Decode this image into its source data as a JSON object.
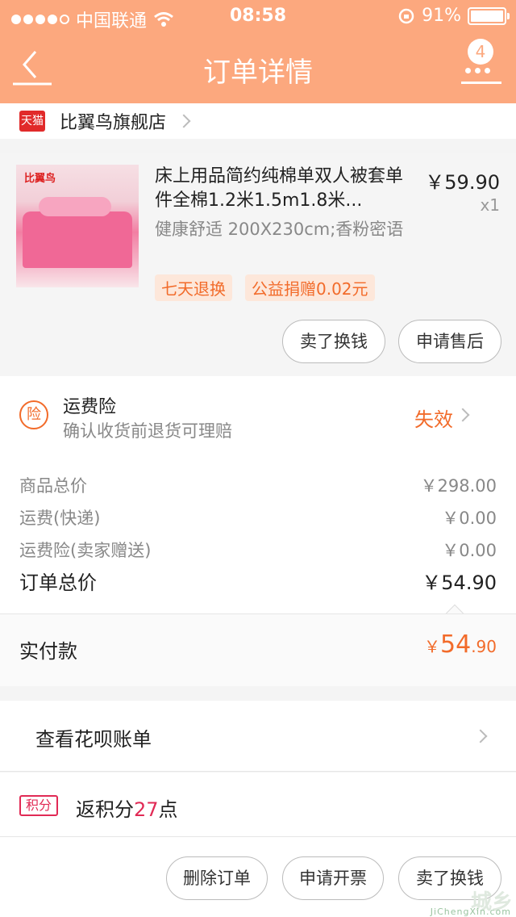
{
  "status_bar": {
    "carrier": "中国联通",
    "time": "08:58",
    "battery": "91%"
  },
  "navbar": {
    "title": "订单详情",
    "badge_count": "4",
    "icons": [
      "back-arrow-icon",
      "more-icon"
    ]
  },
  "shop": {
    "badge": "天猫",
    "name": "比翼鸟旗舰店"
  },
  "product": {
    "thumb_logo": "比翼鸟",
    "title": "床上用品简约纯棉单双人被套单件全棉1.2米1.5m1.8米...",
    "sku": "健康舒适 200X230cm;香粉密语",
    "price": "￥59.90",
    "quantity": "x1",
    "tags": [
      "七天退换",
      "公益捐赠0.02元"
    ],
    "buttons": [
      "卖了换钱",
      "申请售后"
    ]
  },
  "insurance": {
    "icon_text": "险",
    "title": "运费险",
    "desc": "确认收货前退货可理赔",
    "status": "失效"
  },
  "summary": {
    "rows": [
      {
        "label": "商品总价",
        "value": "￥298.00"
      },
      {
        "label": "运费(快递)",
        "value": "￥0.00"
      },
      {
        "label": "运费险(卖家赠送)",
        "value": "￥0.00"
      }
    ],
    "total": {
      "label": "订单总价",
      "value": "￥54.90"
    }
  },
  "paid": {
    "label": "实付款",
    "currency": "￥",
    "integer": "54",
    "decimal": ".90"
  },
  "huabei": {
    "label": "查看花呗账单"
  },
  "points": {
    "icon_text": "积分",
    "prefix": "返积分",
    "number": "27",
    "suffix": "点"
  },
  "actions": {
    "buttons": [
      "删除订单",
      "申请开票",
      "卖了换钱"
    ]
  },
  "watermark": {
    "text": "城乡",
    "sub": "JiChengXin.com"
  },
  "colors": {
    "header": "#fca87e",
    "accent": "#f26b2a",
    "points": "#e12a55"
  }
}
